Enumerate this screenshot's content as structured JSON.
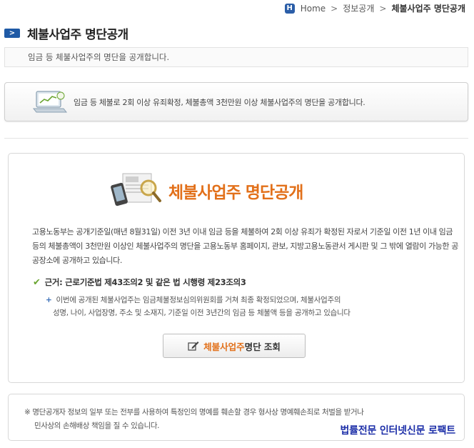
{
  "breadcrumb": {
    "home_badge": "H",
    "home": "Home",
    "sep": ">",
    "section": "정보공개",
    "current": "체불사업주 명단공개"
  },
  "page": {
    "bullet": ">",
    "title": "체불사업주 명단공개",
    "intro": "임금 등 체불사업주의 명단을 공개합니다."
  },
  "summary": {
    "text": "임금 등 체불로 2회 이상 유죄확정, 체불총액 3천만원 이상 체불사업주의 명단을 공개합니다."
  },
  "main": {
    "hero_title": "체불사업주 명단공개",
    "description": "고용노동부는 공개기준일(매년 8월31일) 이전 3년 이내 임금 등을 체불하여 2회 이상 유죄가 확정된 자로서 기준일 이전 1년 이내 임금 등의 체불총액이 3천만원 이상인 체불사업주의 명단을 고용노동부 홈페이지, 관보, 지방고용노동관서 게시판 및 그 밖에 열람이 가능한 공공장소에 공개하고 있습니다.",
    "basis": "근거: 근로기준법 제43조의2 및 같은 법 시행령 제23조의3",
    "note_line1": "이번에 공개된 체불사업주는 임금체불정보심의위원회를 거쳐 최종 확정되었으며, 체불사업주의",
    "note_line2": "성명, 나이, 사업장명, 주소 및 소재지, 기준일 이전 3년간의 임금 등 체불액 등을 공개하고 있습니다",
    "note_marker": "+",
    "check_mark": "✔",
    "button_accent": "체불사업주",
    "button_rest": " 명단 조회"
  },
  "footer": {
    "line1": "※ 명단공개자 정보의 일부 또는 전부를 사용하여 특정인의 명예를 훼손할 경우 형사상 명예훼손죄로 처벌을 받거나",
    "line2": "민사상의 손해배상 책임을 질 수 있습니다.",
    "watermark": "법률전문 인터넷신문 로팩트"
  },
  "colors": {
    "accent_orange": "#e2701a",
    "brand_blue": "#1f5aa6",
    "check_green": "#6aa531"
  }
}
